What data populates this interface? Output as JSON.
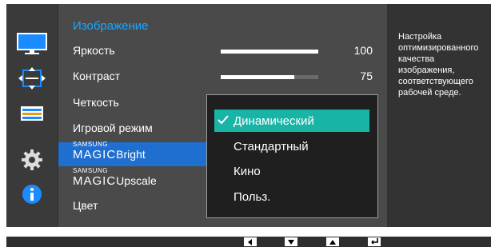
{
  "menu": {
    "title": "Изображение",
    "items": [
      {
        "label": "Яркость",
        "value": "100",
        "level": 1.0
      },
      {
        "label": "Контраст",
        "value": "75",
        "level": 0.75
      },
      {
        "label": "Четкость"
      },
      {
        "label": "Игровой режим"
      },
      {
        "brand_small": "SAMSUNG",
        "brand_large": "MAGIC",
        "label": "Bright"
      },
      {
        "brand_small": "SAMSUNG",
        "brand_large": "MAGIC",
        "label": "Upscale"
      },
      {
        "label": "Цвет"
      }
    ]
  },
  "dropdown": {
    "options": [
      "Динамический",
      "Стандартный",
      "Кино",
      "Польз."
    ],
    "selected_index": 0
  },
  "help": {
    "text": "Настройка оптимизированного качества изображения, соответствующего рабочей среде."
  },
  "sidebar": {
    "icons": [
      "monitor-icon",
      "position-arrows-icon",
      "menu-bars-icon",
      "gear-icon",
      "info-icon"
    ]
  },
  "colors": {
    "accent": "#1aa6ff",
    "selected_item": "#1f6fd1",
    "selected_option": "#18b5a7"
  },
  "buttons": [
    "left-arrow-icon",
    "down-arrow-icon",
    "up-arrow-icon",
    "enter-icon"
  ]
}
